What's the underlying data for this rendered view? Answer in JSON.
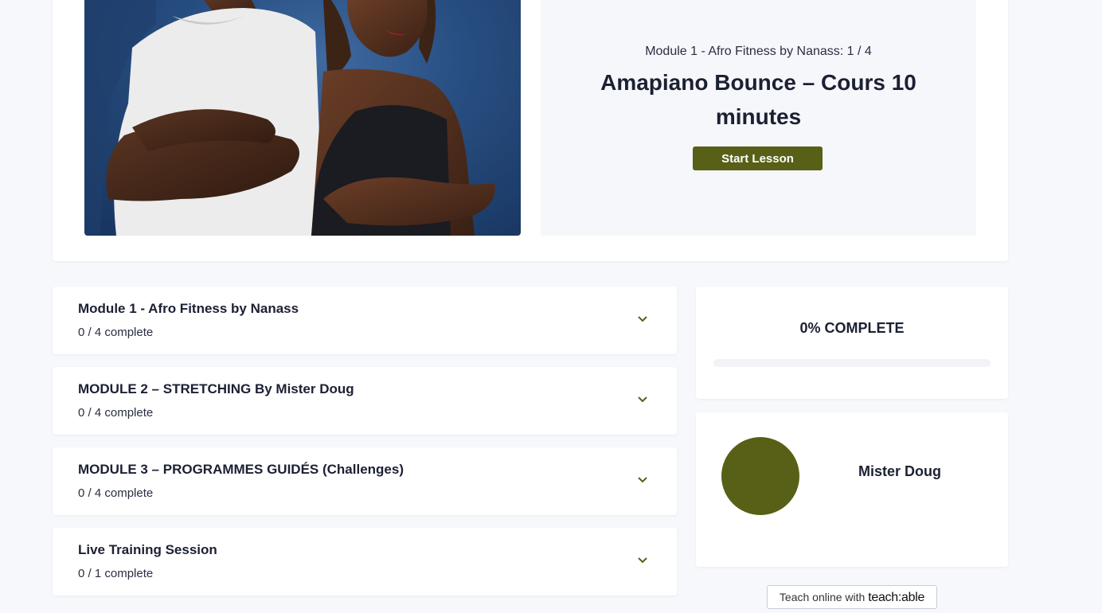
{
  "hero": {
    "module_line": "Module 1 - Afro Fitness by Nanass: 1 / 4",
    "lesson_title": "Amapiano Bounce – Cours 10 minutes",
    "start_button": "Start Lesson"
  },
  "modules": [
    {
      "title": "Module 1 - Afro Fitness by Nanass",
      "progress": "0 / 4 complete"
    },
    {
      "title": "MODULE 2 – STRETCHING By Mister Doug",
      "progress": "0 / 4 complete"
    },
    {
      "title": "MODULE 3 – PROGRAMMES GUIDÉS (Challenges)",
      "progress": "0 / 4 complete"
    },
    {
      "title": "Live Training Session",
      "progress": "0 / 1 complete"
    }
  ],
  "course_progress": {
    "label": "0% COMPLETE",
    "percent": 0
  },
  "author": {
    "name": "Mister Doug"
  },
  "footer": {
    "badge_prefix": "Teach online with",
    "badge_brand": "teach:able"
  },
  "icons": {
    "module_toggle": "chevron-down-icon"
  },
  "colors": {
    "accent": "#576016",
    "page_background": "#f6f8fc",
    "card_background": "#ffffff",
    "text": "#1c2033"
  }
}
